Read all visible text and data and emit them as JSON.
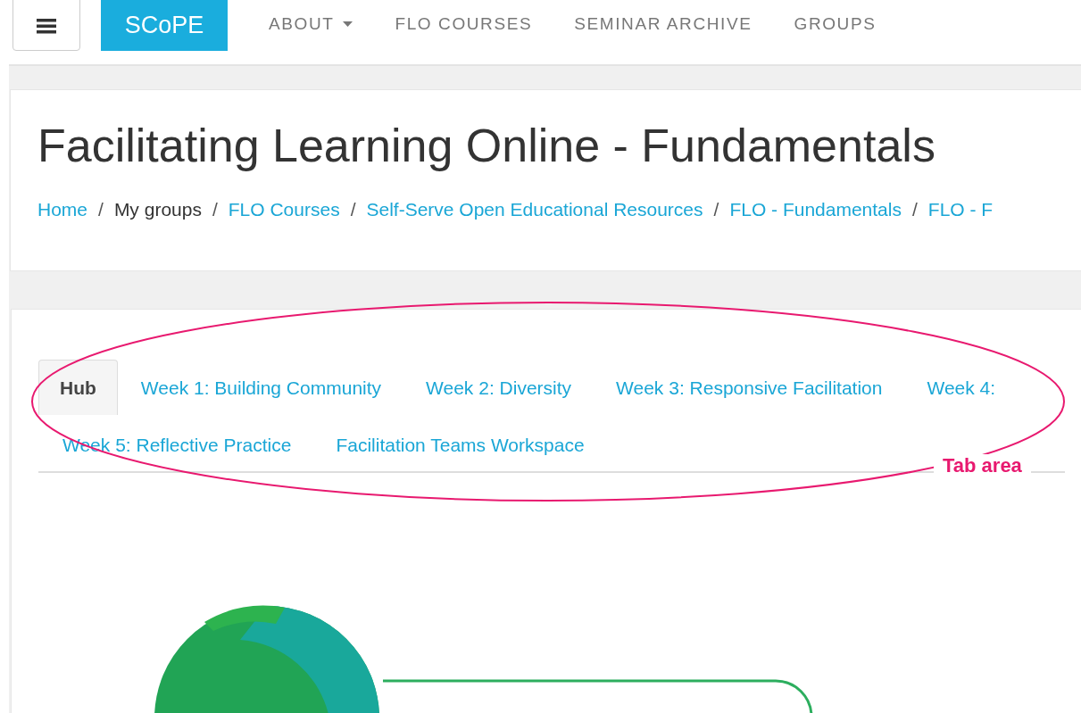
{
  "navbar": {
    "logo": "SCoPE",
    "links": [
      {
        "label": "ABOUT",
        "dropdown": true
      },
      {
        "label": "FLO COURSES",
        "dropdown": false
      },
      {
        "label": "SEMINAR ARCHIVE",
        "dropdown": false
      },
      {
        "label": "GROUPS",
        "dropdown": false
      }
    ]
  },
  "page_title": "Facilitating Learning Online - Fundamentals",
  "breadcrumb_separator": "/",
  "breadcrumbs": [
    {
      "label": "Home",
      "kind": "link"
    },
    {
      "label": "My groups",
      "kind": "text"
    },
    {
      "label": "FLO Courses",
      "kind": "link"
    },
    {
      "label": "Self-Serve Open Educational Resources",
      "kind": "link"
    },
    {
      "label": "FLO - Fundamentals",
      "kind": "link"
    },
    {
      "label": "FLO - F",
      "kind": "link"
    }
  ],
  "tabs": [
    {
      "label": "Hub",
      "selected": true
    },
    {
      "label": "Week 1: Building Community",
      "selected": false
    },
    {
      "label": "Week 2: Diversity",
      "selected": false
    },
    {
      "label": "Week 3: Responsive Facilitation",
      "selected": false
    },
    {
      "label": "Week 4:",
      "selected": false
    },
    {
      "label": "Week 5: Reflective Practice",
      "selected": false
    },
    {
      "label": "Facilitation Teams Workspace",
      "selected": false
    }
  ],
  "annotation": {
    "label": "Tab area"
  }
}
